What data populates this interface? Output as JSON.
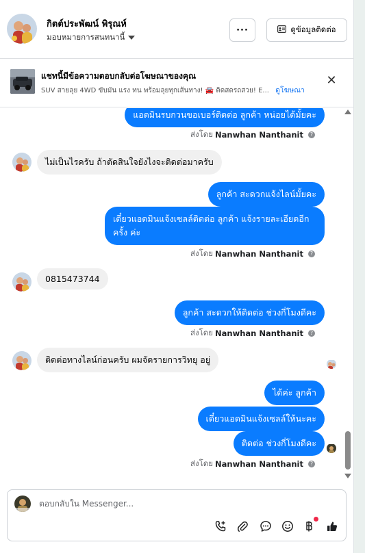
{
  "header": {
    "name": "กิตต์ประพัฒน์ พิรุณห์",
    "assign_label": "มอบหมายการสนทนานี้",
    "more_label": "···",
    "contact_label": "ดูข้อมูลติดต่อ"
  },
  "ad_banner": {
    "title": "แชทนี้มีข้อความตอบกลับต่อโฆษณาของคุณ",
    "subtitle": "SUV สายลุย 4WD ขับมัน แรง ทน พร้อมลุยทุกเส้นทาง! 🚘 ติดสดรถสวย! E...",
    "link": "ดูโฆษณา",
    "close_label": "✕"
  },
  "chat": {
    "messages": [
      {
        "type": "out",
        "text": "แอดมินรบกวนขอเบอร์ติดต่อ ลูกค้า หน่อยได้มั้ยคะ"
      },
      {
        "type": "sent_by",
        "prefix": "ส่งโดย",
        "name": "Nanwhan Nanthanit"
      },
      {
        "type": "in",
        "text": "ไม่เป็นไรครับ ถ้าตัดสินใจยังไงจะติดต่อมาครับ"
      },
      {
        "type": "out",
        "text": "ลูกค้า สะดวกแจ้งไลน์มั้ยคะ"
      },
      {
        "type": "out",
        "text": "เดี๋ยวแอดมินแจ้งเซลล์ติดต่อ ลูกค้า แจ้งรายละเอียดอีกครั้ง ค่ะ"
      },
      {
        "type": "sent_by",
        "prefix": "ส่งโดย",
        "name": "Nanwhan Nanthanit"
      },
      {
        "type": "in",
        "text": "0815473744"
      },
      {
        "type": "out",
        "text": "ลูกค้า สะดวกให้ติดต่อ ช่วงกี่โมงดีคะ"
      },
      {
        "type": "sent_by",
        "prefix": "ส่งโดย",
        "name": "Nanwhan Nanthanit"
      },
      {
        "type": "in",
        "text": "ติดต่อทางไลน์ก่อนครับ ผมจัดรายการวิทยุ อยู่"
      },
      {
        "type": "out",
        "text": "ได้ค่ะ  ลูกค้า"
      },
      {
        "type": "out",
        "text": "เดี๋ยวแอดมินแจ้งเซลล์ให้นะคะ"
      },
      {
        "type": "out",
        "text": "ติดต่อ ช่วงกี่โมงดีคะ"
      },
      {
        "type": "sent_by",
        "prefix": "ส่งโดย",
        "name": "Nanwhan Nanthanit"
      }
    ]
  },
  "composer": {
    "placeholder": "ตอบกลับใน Messenger...",
    "value": ""
  },
  "colors": {
    "accent": "#0a7cff",
    "link": "#1877f2",
    "incoming_bubble": "#f0f0f0",
    "notification": "#f02849"
  },
  "icons": [
    "avatar",
    "chevron-down-icon",
    "more-icon",
    "contact-card-icon",
    "close-icon",
    "info-icon",
    "add-call-icon",
    "attachment-icon",
    "chat-bubble-icon",
    "emoji-icon",
    "baht-icon",
    "thumbs-up-icon"
  ]
}
